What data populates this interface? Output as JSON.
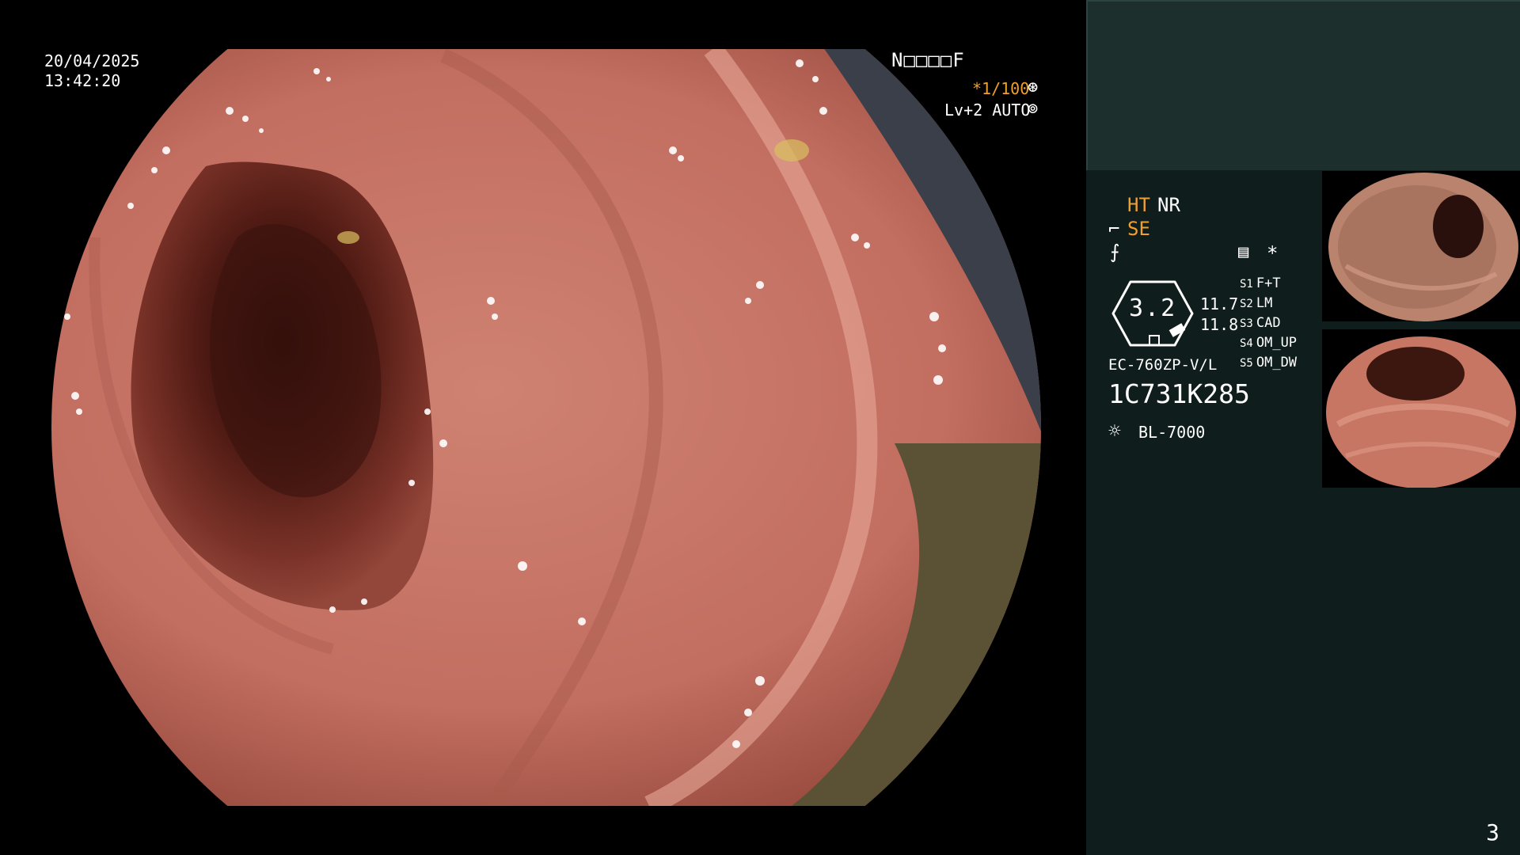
{
  "overlay": {
    "date": "20/04/2025",
    "time": "13:42:20",
    "patient_id": "N□□□□F",
    "shutter": "*1/100",
    "shutter_icon": "shutter-icon",
    "level": "Lv+2 AUTO",
    "auto_icon": "auto-exposure-icon"
  },
  "side_panel": {
    "ht": "HT",
    "nr": "NR",
    "se_icon": "⌐",
    "se": "SE",
    "eq_icon": "⨍",
    "menu_icon": "▤",
    "star": "*",
    "gauge_value": "3.2",
    "value_a": "11.7",
    "value_b": "11.8",
    "slots": [
      {
        "key": "S1",
        "label": "F+T"
      },
      {
        "key": "S2",
        "label": "LM"
      },
      {
        "key": "S3",
        "label": "CAD"
      },
      {
        "key": "S4",
        "label": "OM_UP"
      },
      {
        "key": "S5",
        "label": "OM_DW"
      }
    ],
    "scope_model": "EC-760ZP-V/L",
    "serial": "1C731K285",
    "light_icon": "☼",
    "light_source": "BL-7000"
  },
  "page_number": "3",
  "colors": {
    "accent_orange": "#f0a030",
    "panel_bg": "#0f1e1c",
    "panel_top_bg": "#1c2f2c",
    "mucosa": "#c9766a"
  }
}
